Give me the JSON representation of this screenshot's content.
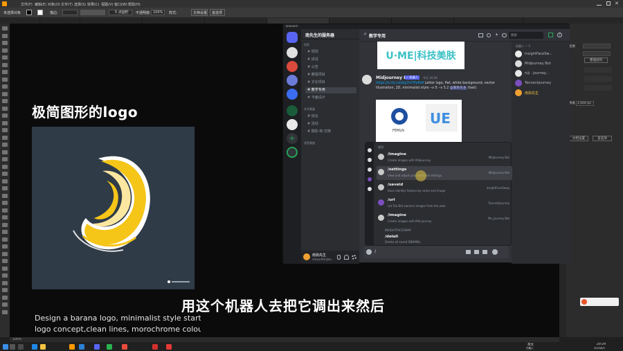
{
  "illustrator": {
    "menus": [
      "文件(F)",
      "编辑(E)",
      "对象(O)",
      "文字(T)",
      "选择(S)",
      "效果(C)",
      "视图(V)",
      "窗口(W)",
      "帮助(H)"
    ],
    "control_bar": {
      "selection_label": "未选择对象",
      "stroke_label": "描边:",
      "style_label": "5 点圆形",
      "opacity_label": "不透明度:",
      "opacity_value": "100%",
      "style_field": "样式:",
      "doc_setup": "文档设置",
      "prefs": "首选项"
    },
    "status": {
      "zoom": "100%"
    }
  },
  "artboard": {
    "headline": "极简图形的logo",
    "prompt_line1": "Design a barana logo, minimalist style startup",
    "prompt_line2": "logo concept,clean lines, morochrome colour",
    "subtitle": "用这个机器人去把它调出来然后",
    "logo_colors": {
      "background": "#2f3b47",
      "primary": "#f5c518",
      "light": "#fbe7a0",
      "outline": "#ffffff"
    }
  },
  "discord": {
    "app_title": "Discord",
    "server_name": "南先生的服务器",
    "channel_name": "教学专用",
    "search_placeholder": "搜索",
    "categories": [
      "信息",
      "文字频道",
      "语音频道"
    ],
    "channels_group1": [
      "规则",
      "讲话",
      "公告",
      "教程项目",
      "文化项目",
      "教学专用",
      "平面设计"
    ],
    "channels_group2": [
      "综合",
      "活动",
      "摄影·和·交换"
    ],
    "message": {
      "author": "Midjourney Bot",
      "bot_tag": "✓ 机器人",
      "timestamp": "今天 20:29",
      "link": "https://s.mj.run/kg7nl7PyPa4",
      "text": "Letter logo, flat, white background, vector illustration, 2D, minimalist style --v 5 --s 5.2",
      "mention": "@南狗先生",
      "status": "(fast)"
    },
    "banner_text": "U·ME|科技美肤",
    "preview_tiles": [
      "FEMLN",
      "UE"
    ],
    "popup": {
      "header": "使用",
      "section2": "INSIGHTFACESWAP",
      "commands": [
        {
          "name": "/imagine",
          "desc": "Create images with Midjourney",
          "bot": "Midjourney Bot"
        },
        {
          "name": "/settings",
          "desc": "View and adjust your personal settings.",
          "bot": "Midjourney Bot"
        },
        {
          "name": "/saveid",
          "desc": "Save identity feature by name and image",
          "bot": "InsightFaceSwap"
        },
        {
          "name": "/url",
          "desc": "Let Tao Bot workers images from the web.",
          "bot": "Tencentjourney"
        },
        {
          "name": "/imagine",
          "desc": "Create images with Mid journey",
          "bot": "Me_journey Bot"
        }
      ],
      "last_command": {
        "name": "/delall",
        "desc": "Delete all saved IDNAMEs"
      }
    },
    "input_text": "/",
    "user": {
      "name": "南驹先生",
      "tag": "nanyu#anjian..."
    },
    "members_header": "机器人 — 5",
    "members": [
      "InsightFaceSw...",
      "Midjourney Bot",
      "niji · journey...",
      "Tencentjourney",
      "南驹先生"
    ]
  },
  "right_panel": {
    "label_transform": "变换",
    "label_none": "无",
    "button_arrange": "整理排列",
    "label_unit": "像素",
    "value_w": "1,000 px",
    "button_doc": "文档设置",
    "button_pref": "首选项"
  },
  "taskbar": {
    "lang": "英文",
    "ime": "已输入",
    "time": "20:29",
    "date": "2023/8/3"
  }
}
